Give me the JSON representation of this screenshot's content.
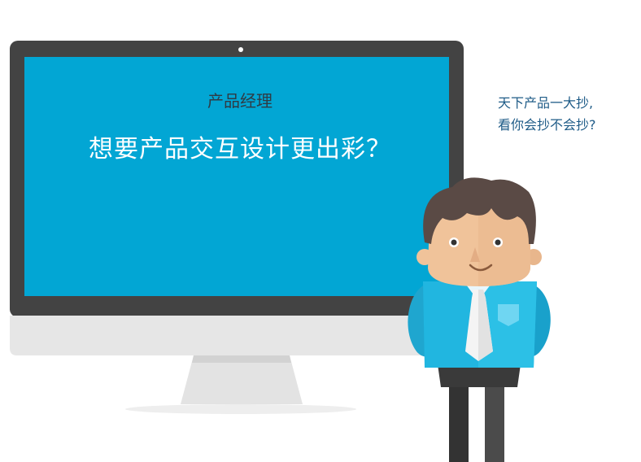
{
  "screen": {
    "subtitle": "产品经理",
    "headline": "想要产品交互设计更出彩？"
  },
  "speech": {
    "line1": "天下产品一大抄,",
    "line2": "看你会抄不会抄?"
  },
  "colors": {
    "screen_blue": "#02a6d4",
    "bezel": "#434343",
    "monitor_chin": "#e6e6e6",
    "shirt": "#21b6e0",
    "hair": "#5a4a45",
    "skin": "#f0c39a",
    "quote_text": "#1e5b87"
  }
}
